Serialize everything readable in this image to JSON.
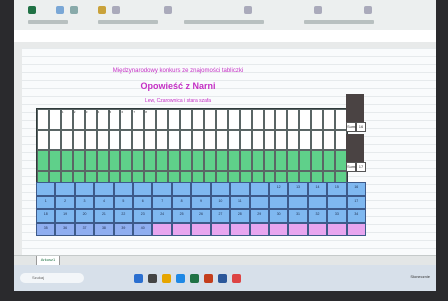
{
  "spreadsheet": {
    "title_subtitle": "Międzynarodowy konkurs ze znajomości tabliczki",
    "title_main": "Opowieść z Narni",
    "title_description": "Lew, Czarownica i stara szafa",
    "sheet_tab": "Arkusz1",
    "top_label_cells": [
      "1",
      "2",
      "3",
      "4",
      "5",
      "6",
      "7",
      "8"
    ],
    "side_labels": {
      "top_right": "Suma",
      "top_right_value": "16",
      "bottom_right": "Suma",
      "bottom_right_value": "17"
    },
    "grid_rows": [
      {
        "color": "#ffffff"
      },
      {
        "color": "#ffffff"
      },
      {
        "color": "#5fd08a"
      },
      {
        "color": "#5fd08a"
      }
    ],
    "number_rows": [
      {
        "color": "#7fb8f0",
        "values": [
          "",
          "",
          "",
          "",
          "",
          "",
          "",
          "",
          "",
          "",
          "",
          "",
          "12",
          "13",
          "14",
          "15",
          "16"
        ]
      },
      {
        "color": "#7fb8f0",
        "values": [
          "1",
          "2",
          "3",
          "4",
          "5",
          "6",
          "7",
          "8",
          "9",
          "10",
          "11",
          "",
          "",
          "",
          "",
          "",
          "17"
        ]
      },
      {
        "color": "#7fb8f0",
        "values": [
          "18",
          "19",
          "20",
          "21",
          "22",
          "23",
          "24",
          "25",
          "26",
          "27",
          "28",
          "29",
          "30",
          "31",
          "32",
          "33",
          "34"
        ]
      },
      {
        "color": "#8faef0",
        "values": [
          "35",
          "36",
          "37",
          "38",
          "39",
          "40",
          "",
          "",
          "",
          "",
          "",
          "",
          "",
          "",
          "",
          "",
          ""
        ]
      }
    ]
  },
  "taskbar": {
    "search_placeholder": "Szukaj",
    "tray_text": "Słonecznie"
  },
  "colors": {
    "title": "#c42fc4",
    "green": "#5fd08a",
    "blue": "#7fb8f0",
    "pink": "#e7a5ef",
    "excel_green": "#207245"
  }
}
